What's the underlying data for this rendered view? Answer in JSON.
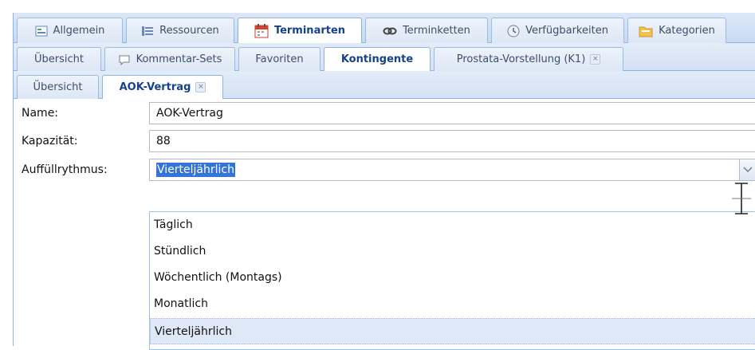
{
  "tabs_level1": [
    {
      "label": "Allgemein",
      "icon": "form-icon",
      "active": false
    },
    {
      "label": "Ressourcen",
      "icon": "list-icon",
      "active": false
    },
    {
      "label": "Terminarten",
      "icon": "calendar-icon",
      "active": true
    },
    {
      "label": "Terminketten",
      "icon": "chain-icon",
      "active": false
    },
    {
      "label": "Verfügbarkeiten",
      "icon": "clock-icon",
      "active": false
    },
    {
      "label": "Kategorien",
      "icon": "folder-icon",
      "active": false
    }
  ],
  "tabs_level2": [
    {
      "label": "Übersicht",
      "active": false
    },
    {
      "label": "Kommentar-Sets",
      "icon": "comment-icon",
      "active": false
    },
    {
      "label": "Favoriten",
      "active": false
    },
    {
      "label": "Kontingente",
      "active": true
    },
    {
      "label": "Prostata-Vorstellung (K1)",
      "closable": true,
      "active": false
    }
  ],
  "tabs_level3": [
    {
      "label": "Übersicht",
      "active": false
    },
    {
      "label": "AOK-Vertrag",
      "closable": true,
      "active": true
    }
  ],
  "form": {
    "name_label": "Name:",
    "name_value": "AOK-Vertrag",
    "capacity_label": "Kapazität:",
    "capacity_value": "88",
    "refill_label": "Auffüllrythmus:",
    "refill_value": "Vierteljährlich"
  },
  "dropdown": {
    "options": [
      "Täglich",
      "Stündlich",
      "Wöchentlich (Montags)",
      "Monatlich",
      "Vierteljährlich"
    ],
    "selected": "Vierteljährlich"
  },
  "colors": {
    "accent": "#15428b",
    "selection": "#3473d8",
    "tab_border": "#99bbe8",
    "list_selected": "#dfe8f6"
  }
}
